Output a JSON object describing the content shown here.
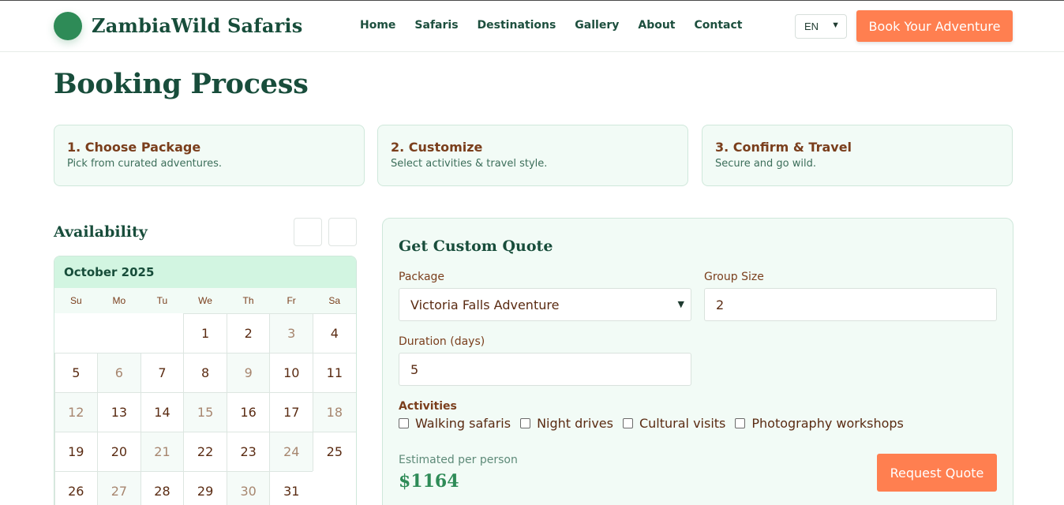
{
  "header": {
    "brand": "ZambiaWild Safaris",
    "nav": [
      "Home",
      "Safaris",
      "Destinations",
      "Gallery",
      "About",
      "Contact"
    ],
    "language": "EN",
    "cta": "Book Your Adventure"
  },
  "page": {
    "title": "Booking Process"
  },
  "steps": [
    {
      "title": "1. Choose Package",
      "desc": "Pick from curated adventures."
    },
    {
      "title": "2. Customize",
      "desc": "Select activities & travel style."
    },
    {
      "title": "3. Confirm & Travel",
      "desc": "Secure and go wild."
    }
  ],
  "availability": {
    "title": "Availability",
    "month": "October 2025",
    "weekdays": [
      "Su",
      "Mo",
      "Tu",
      "We",
      "Th",
      "Fr",
      "Sa"
    ],
    "leading_blanks": 3,
    "days": [
      {
        "d": "1",
        "m": false
      },
      {
        "d": "2",
        "m": false
      },
      {
        "d": "3",
        "m": true
      },
      {
        "d": "4",
        "m": false
      },
      {
        "d": "5",
        "m": false
      },
      {
        "d": "6",
        "m": true
      },
      {
        "d": "7",
        "m": false
      },
      {
        "d": "8",
        "m": false
      },
      {
        "d": "9",
        "m": true
      },
      {
        "d": "10",
        "m": false
      },
      {
        "d": "11",
        "m": false
      },
      {
        "d": "12",
        "m": true
      },
      {
        "d": "13",
        "m": false
      },
      {
        "d": "14",
        "m": false
      },
      {
        "d": "15",
        "m": true
      },
      {
        "d": "16",
        "m": false
      },
      {
        "d": "17",
        "m": false
      },
      {
        "d": "18",
        "m": true
      },
      {
        "d": "19",
        "m": false
      },
      {
        "d": "20",
        "m": false
      },
      {
        "d": "21",
        "m": true
      },
      {
        "d": "22",
        "m": false
      },
      {
        "d": "23",
        "m": false
      },
      {
        "d": "24",
        "m": true
      },
      {
        "d": "25",
        "m": false
      },
      {
        "d": "26",
        "m": false
      },
      {
        "d": "27",
        "m": true
      },
      {
        "d": "28",
        "m": false
      },
      {
        "d": "29",
        "m": false
      },
      {
        "d": "30",
        "m": true
      },
      {
        "d": "31",
        "m": false
      }
    ]
  },
  "quote": {
    "title": "Get Custom Quote",
    "package_label": "Package",
    "package_value": "Victoria Falls Adventure",
    "group_label": "Group Size",
    "group_value": "2",
    "duration_label": "Duration (days)",
    "duration_value": "5",
    "activities_label": "Activities",
    "activities": [
      "Walking safaris",
      "Night drives",
      "Cultural visits",
      "Photography workshops"
    ],
    "estimate_label": "Estimated per person",
    "estimate_value": "$1164",
    "request_label": "Request Quote"
  },
  "colors": {
    "primary": "#2e8b57",
    "accent": "#ff7f50",
    "heading": "#184d3b",
    "panel": "#f2fbf6"
  }
}
